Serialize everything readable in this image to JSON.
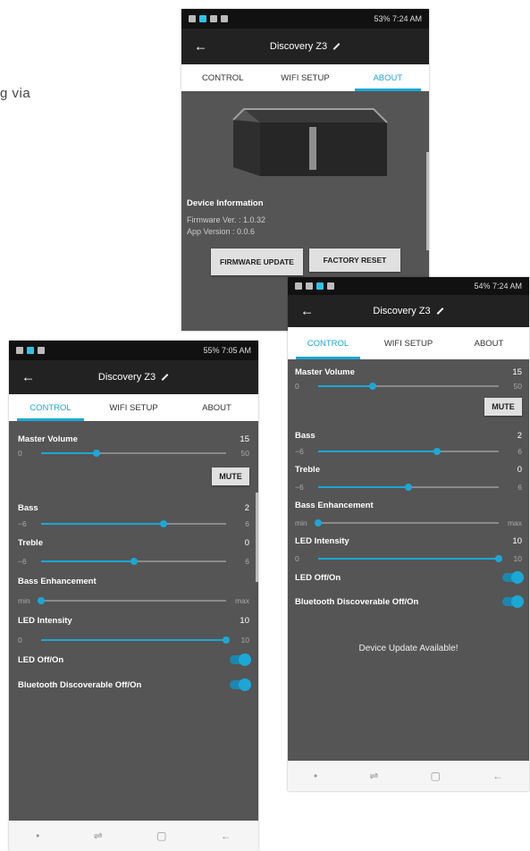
{
  "background_text": "g via",
  "app": {
    "title": "Discovery Z3",
    "tabs": [
      "CONTROL",
      "WIFI SETUP",
      "ABOUT"
    ]
  },
  "phone_about": {
    "status": {
      "right": "53% 7:24 AM"
    },
    "device_info_label": "Device Information",
    "firmware_ver": "Firmware Ver. : 1.0.32",
    "app_version": "App Version : 0.0.6",
    "firmware_update_btn": "FIRMWARE UPDATE",
    "factory_reset_btn": "FACTORY RESET"
  },
  "phone_left": {
    "status": {
      "right": "55% 7:05 AM"
    },
    "master_volume": {
      "label": "Master Volume",
      "value": "15",
      "min": "0",
      "max": "50"
    },
    "mute_label": "MUTE",
    "bass": {
      "label": "Bass",
      "value": "2",
      "min": "−6",
      "max": "6"
    },
    "treble": {
      "label": "Treble",
      "value": "0",
      "min": "−6",
      "max": "6"
    },
    "bass_enh": {
      "label": "Bass Enhancement",
      "min": "min",
      "max": "max"
    },
    "led_intensity": {
      "label": "LED Intensity",
      "value": "10",
      "min": "0",
      "max": "10"
    },
    "led_toggle": "LED Off/On",
    "bt_toggle": "Bluetooth Discoverable Off/On"
  },
  "phone_right": {
    "status": {
      "right": "54% 7:24 AM"
    },
    "master_volume": {
      "label": "Master Volume",
      "value": "15",
      "min": "0",
      "max": "50"
    },
    "mute_label": "MUTE",
    "bass": {
      "label": "Bass",
      "value": "2",
      "min": "−6",
      "max": "6"
    },
    "treble": {
      "label": "Treble",
      "value": "0",
      "min": "−6",
      "max": "6"
    },
    "bass_enh": {
      "label": "Bass Enhancement",
      "min": "min",
      "max": "max"
    },
    "led_intensity": {
      "label": "LED Intensity",
      "value": "10",
      "min": "0",
      "max": "10"
    },
    "led_toggle": "LED Off/On",
    "bt_toggle": "Bluetooth Discoverable Off/On",
    "update_notice": "Device Update Available!"
  },
  "icons": {
    "back": "arrow-left-icon",
    "edit": "pencil-icon",
    "nav": [
      "dot-icon",
      "recents-icon",
      "home-icon",
      "back-icon"
    ]
  },
  "colors": {
    "accent": "#1ba8d6",
    "panel": "#555555",
    "appbar": "#222222"
  }
}
